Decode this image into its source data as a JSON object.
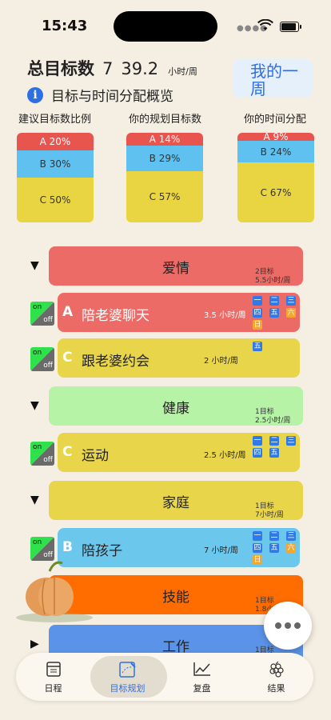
{
  "status": {
    "time": "15:43"
  },
  "header": {
    "title": "总目标数",
    "goal_count": "7",
    "hours": "39.2",
    "hours_unit": "小时/周",
    "week_button": "我的一周",
    "subtitle": "目标与时间分配概览"
  },
  "summary": {
    "columns": [
      {
        "title": "建议目标数比例",
        "a": "A 20%",
        "b": "B 30%",
        "c": "C 50%",
        "a_frac": 0.2,
        "b_frac": 0.3,
        "c_frac": 0.5
      },
      {
        "title": "你的规划目标数",
        "a": "A 14%",
        "b": "B 29%",
        "c": "C 57%",
        "a_frac": 0.14,
        "b_frac": 0.29,
        "c_frac": 0.57
      },
      {
        "title": "你的时间分配",
        "a": "A 9%",
        "b": "B 24%",
        "c": "C 67%",
        "a_frac": 0.09,
        "b_frac": 0.24,
        "c_frac": 0.67
      }
    ]
  },
  "categories": [
    {
      "name": "爱情",
      "goals": "2目标",
      "hours": "5.5小时/周",
      "color": "#ec6b67",
      "expanded": true
    },
    {
      "name": "健康",
      "goals": "1目标",
      "hours": "2.5小时/周",
      "color": "#b6f3a6",
      "expanded": true
    },
    {
      "name": "家庭",
      "goals": "1目标",
      "hours": "7小时/周",
      "color": "#e9d54a",
      "expanded": true
    },
    {
      "name": "技能",
      "goals": "1目标",
      "hours": "1.8小时/周",
      "color": "#ff6d00",
      "expanded": false
    },
    {
      "name": "工作",
      "goals": "1目标",
      "hours": "",
      "color": "#5b93e8",
      "expanded": false
    }
  ],
  "tasks": [
    {
      "letter": "A",
      "name": "陪老婆聊天",
      "hours": "3.5 小时/周",
      "color": "#ec6b67",
      "toggle_on": "on",
      "toggle_off": "off",
      "days": [
        "一",
        "二",
        "三",
        "四",
        "五",
        "六",
        "日"
      ]
    },
    {
      "letter": "C",
      "name": "跟老婆约会",
      "hours": "2 小时/周",
      "color": "#e9d54a",
      "toggle_on": "on",
      "toggle_off": "off",
      "days": [
        "五"
      ]
    },
    {
      "letter": "C",
      "name": "运动",
      "hours": "2.5 小时/周",
      "color": "#e9d54a",
      "toggle_on": "on",
      "toggle_off": "off",
      "days": [
        "一",
        "二",
        "三",
        "四",
        "五"
      ]
    },
    {
      "letter": "B",
      "name": "陪孩子",
      "hours": "7 小时/周",
      "color": "#6cc7ed",
      "toggle_on": "on",
      "toggle_off": "off",
      "days": [
        "一",
        "二",
        "三",
        "四",
        "五",
        "六",
        "日"
      ]
    }
  ],
  "tabbar": {
    "items": [
      {
        "label": "日程",
        "icon": "calendar-icon"
      },
      {
        "label": "目标规划",
        "icon": "goal-plan-icon"
      },
      {
        "label": "复盘",
        "icon": "chart-icon"
      },
      {
        "label": "结果",
        "icon": "grapes-icon"
      }
    ],
    "active": 1
  }
}
